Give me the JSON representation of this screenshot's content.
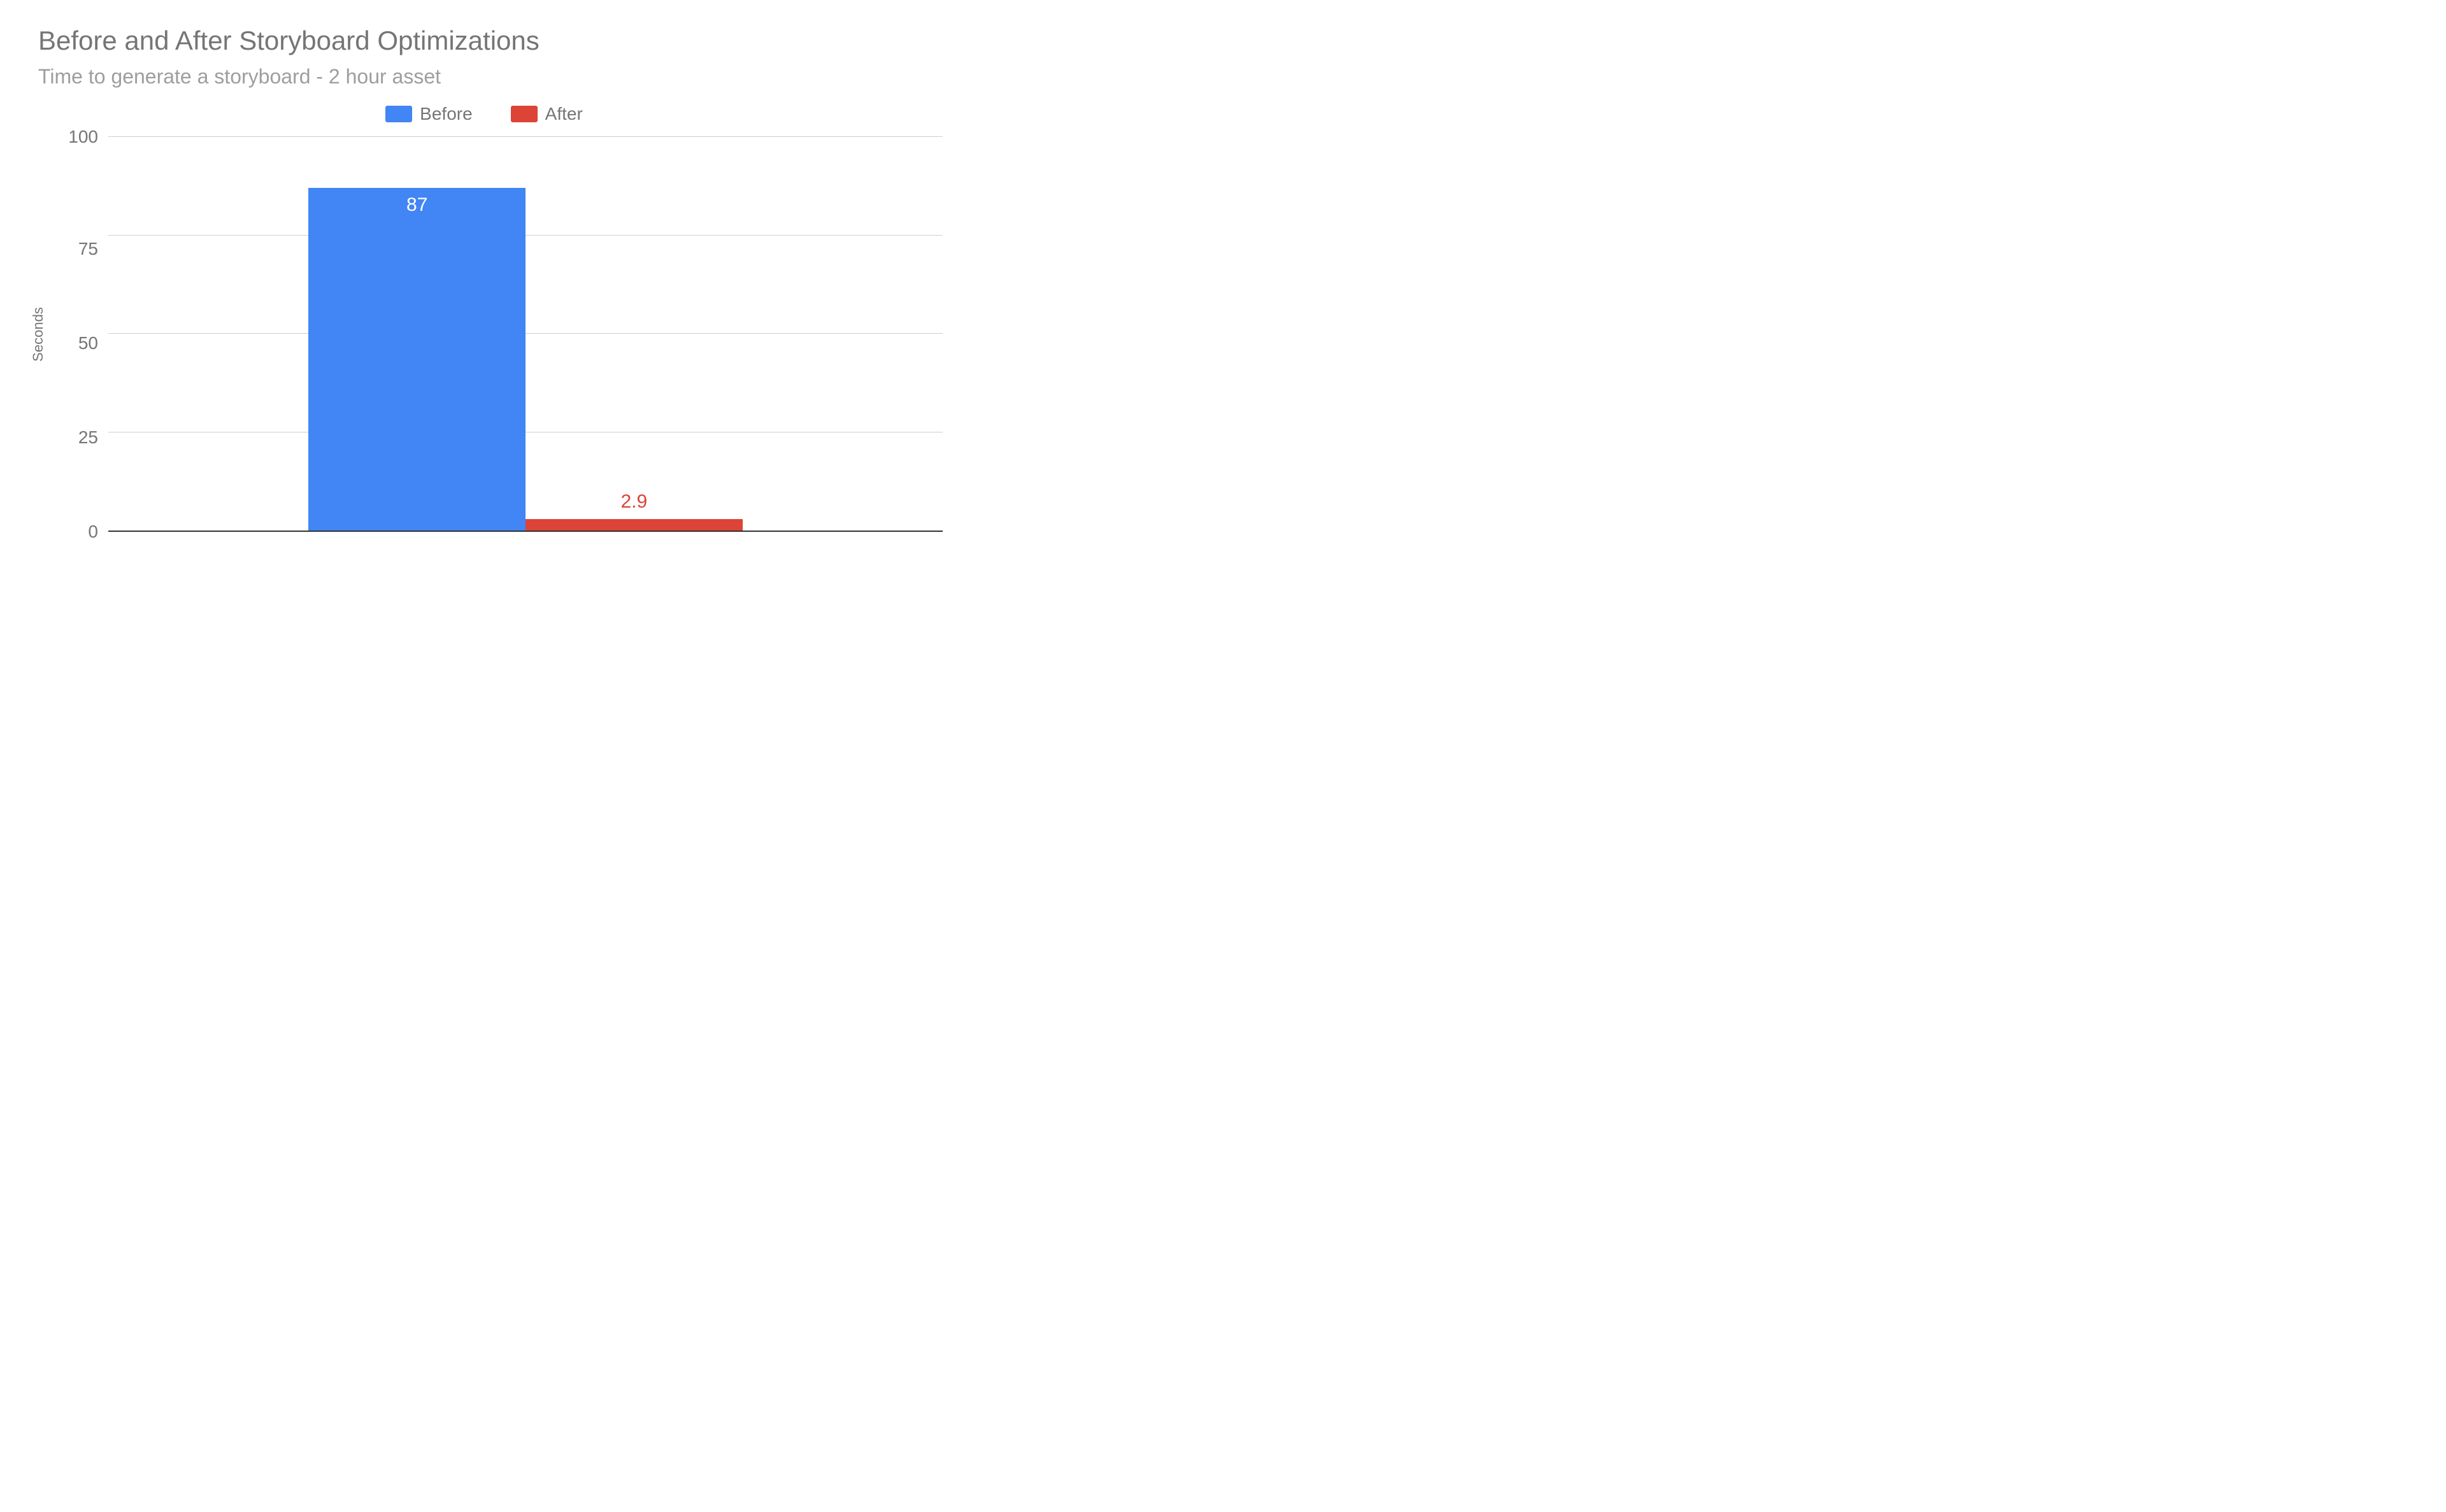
{
  "chart_data": {
    "type": "bar",
    "title": "Before and After Storyboard Optimizations",
    "subtitle": "Time to generate a storyboard - 2 hour asset",
    "ylabel": "Seconds",
    "xlabel": "",
    "ylim": [
      0,
      100
    ],
    "y_ticks": [
      0,
      25,
      50,
      75,
      100
    ],
    "categories": [
      ""
    ],
    "series": [
      {
        "name": "Before",
        "values": [
          87
        ],
        "color": "#4285f4"
      },
      {
        "name": "After",
        "values": [
          2.9
        ],
        "color": "#db4437"
      }
    ],
    "legend_position": "top"
  }
}
